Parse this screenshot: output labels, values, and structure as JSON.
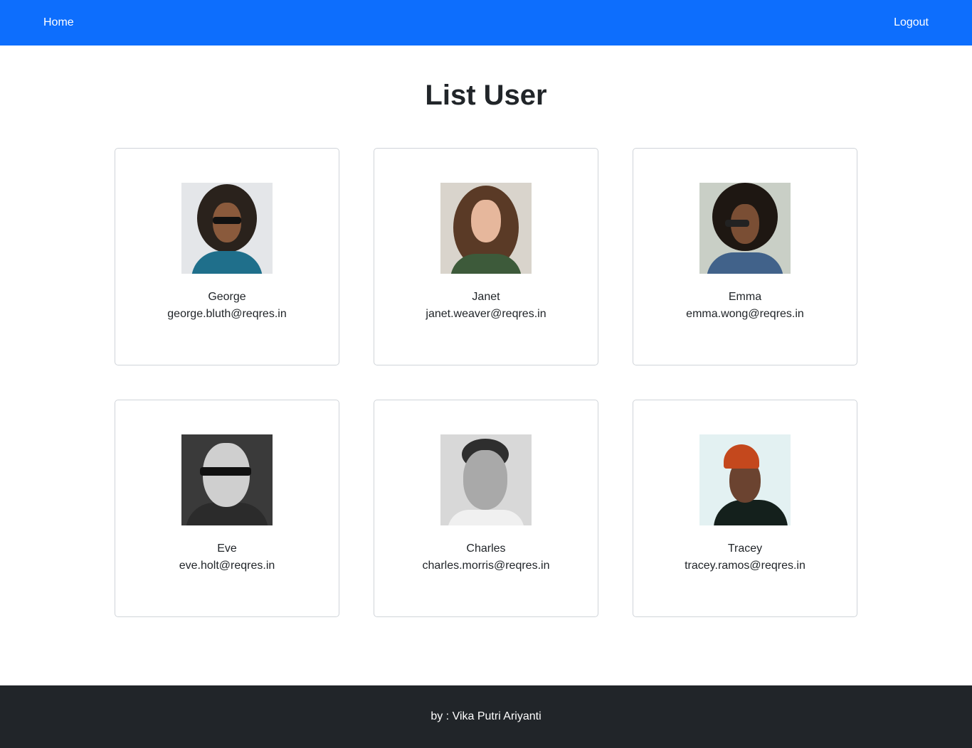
{
  "nav": {
    "home_label": "Home",
    "logout_label": "Logout"
  },
  "page": {
    "title": "List User"
  },
  "users": [
    {
      "name": "George",
      "email": "george.bluth@reqres.in"
    },
    {
      "name": "Janet",
      "email": "janet.weaver@reqres.in"
    },
    {
      "name": "Emma",
      "email": "emma.wong@reqres.in"
    },
    {
      "name": "Eve",
      "email": "eve.holt@reqres.in"
    },
    {
      "name": "Charles",
      "email": "charles.morris@reqres.in"
    },
    {
      "name": "Tracey",
      "email": "tracey.ramos@reqres.in"
    }
  ],
  "footer": {
    "credit": "by : Vika Putri Ariyanti"
  },
  "colors": {
    "navbar": "#0d6efd",
    "footer": "#212529",
    "text": "#212529"
  }
}
